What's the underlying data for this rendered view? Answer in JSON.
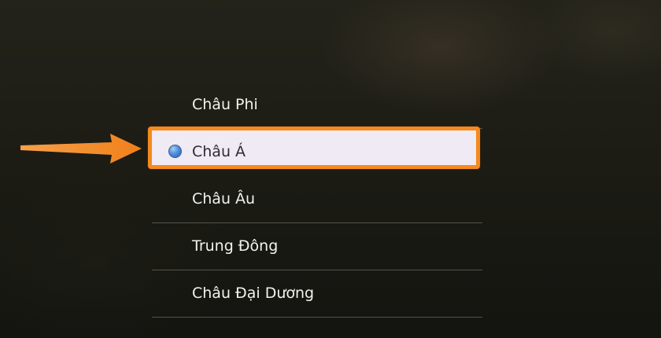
{
  "menu": {
    "items": [
      {
        "label": "Châu Phi",
        "selected": false
      },
      {
        "label": "Châu Á",
        "selected": true
      },
      {
        "label": "Châu Âu",
        "selected": false
      },
      {
        "label": "Trung Đông",
        "selected": false
      },
      {
        "label": "Châu Đại Dương",
        "selected": false
      },
      {
        "label": "",
        "selected": false
      }
    ]
  },
  "colors": {
    "highlight_border": "#f58a1f",
    "highlight_fill": "#efeaf4",
    "arrow": "#f58a1f",
    "radio": "#4f8fdc"
  },
  "icons": {
    "pointer": "arrow-right-icon",
    "selected_marker": "radio-selected-icon"
  }
}
